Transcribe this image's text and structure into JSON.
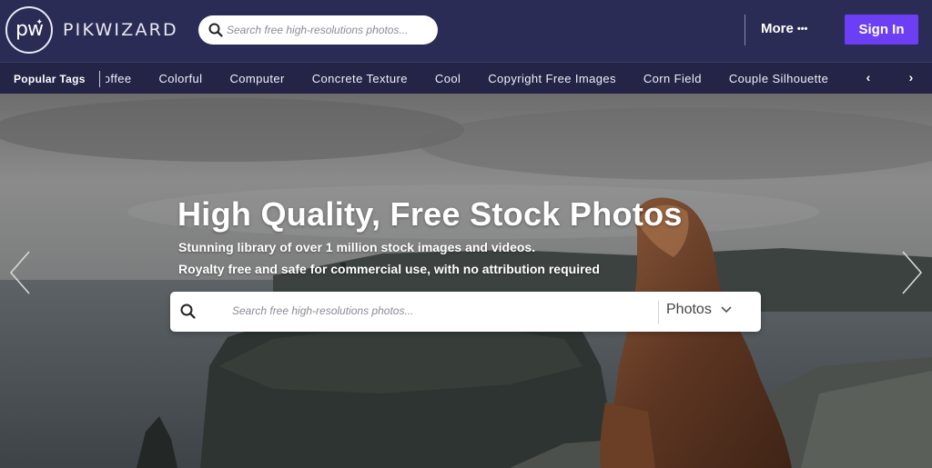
{
  "brand": {
    "logo_letters": "pw",
    "name": "PIKWIZARD"
  },
  "header": {
    "search_placeholder": "Search free high-resolutions photos...",
    "more_label": "More",
    "more_dots": "•••",
    "signin_label": "Sign In"
  },
  "tags": {
    "label": "Popular Tags",
    "items": [
      "Coffee",
      "Colorful",
      "Computer",
      "Concrete Texture",
      "Cool",
      "Copyright Free Images",
      "Corn Field",
      "Couple Silhouette"
    ],
    "prev_glyph": "‹",
    "next_glyph": "›"
  },
  "hero": {
    "title": "High Quality, Free Stock Photos",
    "subtitle_line1": "Stunning library of over 1 million stock images and videos.",
    "subtitle_line2": "Royalty free and safe for commercial use, with no attribution required",
    "search_placeholder": "Search free high-resolutions photos...",
    "type_selected": "Photos"
  },
  "colors": {
    "header_bg": "#2b2c55",
    "tagsbar_bg": "#232446",
    "signin_bg": "#6c3ff5"
  }
}
